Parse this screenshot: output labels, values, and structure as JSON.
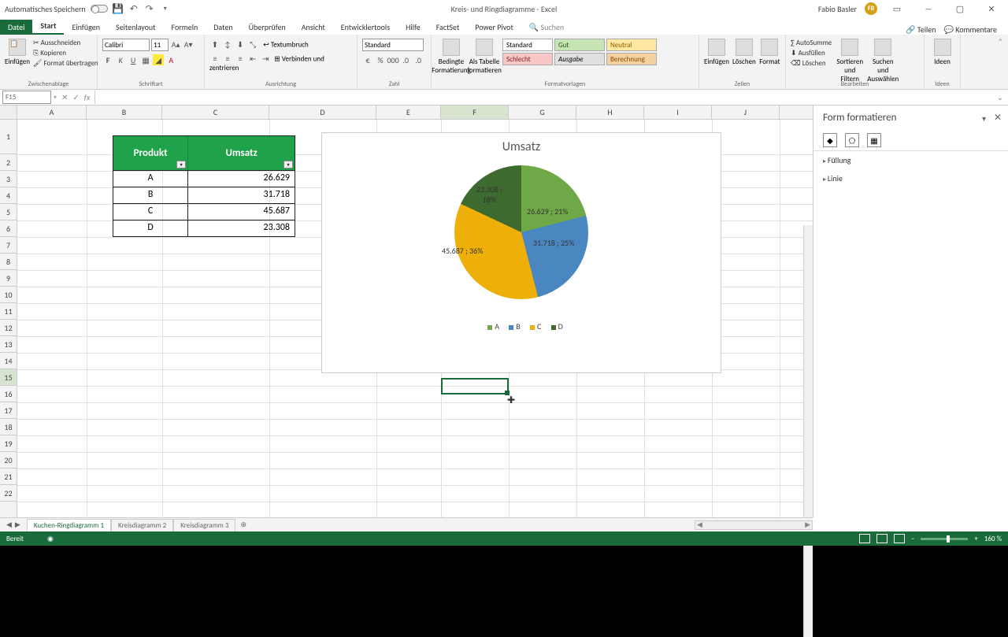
{
  "titlebar": {
    "autosave_label": "Automatisches Speichern",
    "doc_title": "Kreis- und Ringdiagramme - Excel",
    "user_name": "Fabio Basler",
    "user_initials": "FB"
  },
  "tabs": {
    "file": "Datei",
    "list": [
      "Start",
      "Einfügen",
      "Seitenlayout",
      "Formeln",
      "Daten",
      "Überprüfen",
      "Ansicht",
      "Entwicklertools",
      "Hilfe",
      "FactSet",
      "Power Pivot"
    ],
    "search_placeholder": "Suchen",
    "share": "Teilen",
    "comments": "Kommentare"
  },
  "ribbon": {
    "clipboard": {
      "paste": "Einfügen",
      "cut": "Ausschneiden",
      "copy": "Kopieren",
      "format": "Format übertragen",
      "label": "Zwischenablage"
    },
    "font": {
      "name": "Calibri",
      "size": "11",
      "label": "Schriftart"
    },
    "align": {
      "wrap": "Textumbruch",
      "merge": "Verbinden und zentrieren",
      "label": "Ausrichtung"
    },
    "number": {
      "format": "Standard",
      "label": "Zahl"
    },
    "styles": {
      "cond": "Bedingte\nFormatierung",
      "table": "Als Tabelle\nformatieren",
      "standard": "Standard",
      "schlecht": "Schlecht",
      "gut": "Gut",
      "ausgabe": "Ausgabe",
      "neutral": "Neutral",
      "berechnung": "Berechnung",
      "label": "Formatvorlagen"
    },
    "cells": {
      "insert": "Einfügen",
      "delete": "Löschen",
      "format": "Format",
      "label": "Zellen"
    },
    "editing": {
      "sum": "AutoSumme",
      "fill": "Ausfüllen",
      "clear": "Löschen",
      "sort": "Sortieren und\nFiltern",
      "find": "Suchen und\nAuswählen",
      "label": "Bearbeiten"
    },
    "ideas": {
      "label": "Ideen",
      "btn": "Ideen"
    }
  },
  "namebox": "F15",
  "columns": [
    "A",
    "B",
    "C",
    "D",
    "E",
    "F",
    "G",
    "H",
    "I",
    "J"
  ],
  "rows": [
    "1",
    "2",
    "3",
    "4",
    "5",
    "6",
    "7",
    "8",
    "9",
    "10",
    "11",
    "12",
    "13",
    "14",
    "15",
    "16",
    "17",
    "18",
    "19",
    "20",
    "21",
    "22"
  ],
  "table": {
    "h1": "Produkt",
    "h2": "Umsatz",
    "data": [
      {
        "p": "A",
        "u": "26.629"
      },
      {
        "p": "B",
        "u": "31.718"
      },
      {
        "p": "C",
        "u": "45.687"
      },
      {
        "p": "D",
        "u": "23.308"
      }
    ]
  },
  "chart_data": {
    "type": "pie",
    "title": "Umsatz",
    "categories": [
      "A",
      "B",
      "C",
      "D"
    ],
    "values": [
      26629,
      31718,
      45687,
      23308
    ],
    "percent": [
      21,
      25,
      36,
      18
    ],
    "data_labels": [
      "26.629 ; 21%",
      "31.718 ; 25%",
      "45.687 ; 36%",
      "23.308 ;\n18%"
    ],
    "colors": [
      "#6fa846",
      "#4a87c0",
      "#eeb008",
      "#3d6b2f"
    ],
    "legend_position": "bottom"
  },
  "chart_labels": {
    "a": "26.629 ; 21%",
    "b": "31.718 ; 25%",
    "c": "45.687 ; 36%",
    "d1": "23.308 ;",
    "d2": "18%"
  },
  "legend": {
    "a": "A",
    "b": "B",
    "c": "C",
    "d": "D"
  },
  "right_pane": {
    "title": "Form formatieren",
    "item1": "Füllung",
    "item2": "Linie"
  },
  "sheets": {
    "active": "Kuchen-Ringdiagramm 1",
    "s2": "Kreisdiagramm 2",
    "s3": "Kreisdiagramm 3"
  },
  "status": {
    "ready": "Bereit",
    "zoom": "160 %"
  }
}
